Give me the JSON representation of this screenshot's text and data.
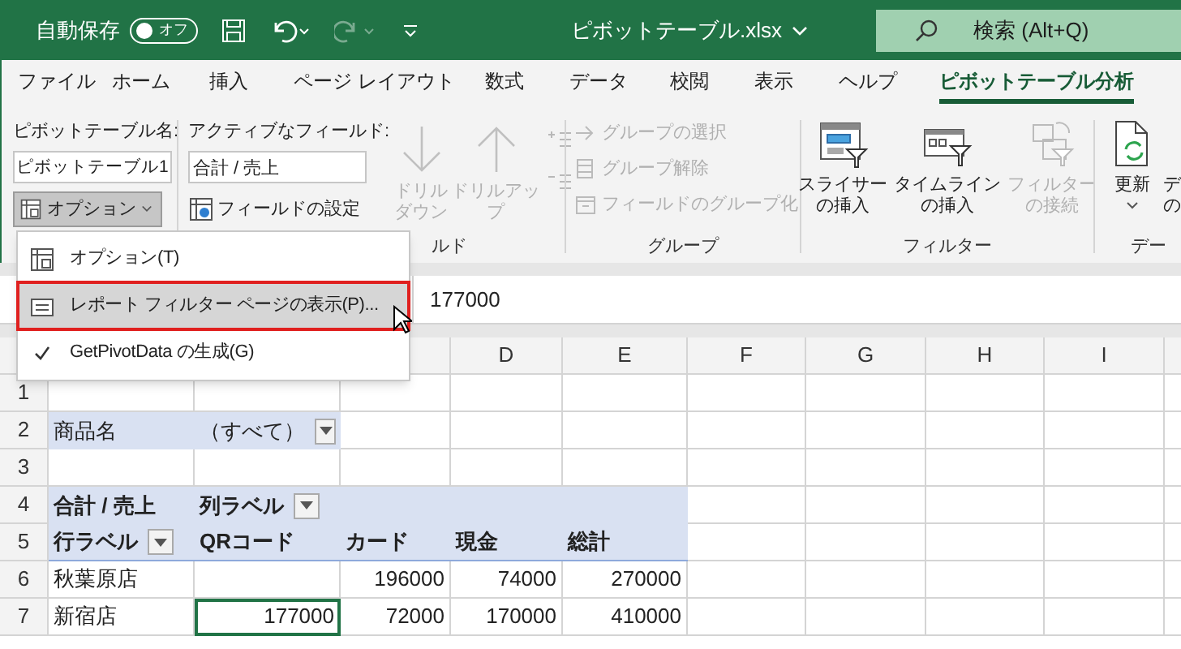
{
  "title_bar": {
    "autosave_label": "自動保存",
    "autosave_toggle": {
      "label": "オフ",
      "on": false
    },
    "filename": "ピボットテーブル.xlsx",
    "search_placeholder": "検索 (Alt+Q)",
    "redo_disabled": true
  },
  "tabs": [
    {
      "label": "ファイル",
      "selected": false
    },
    {
      "label": "ホーム",
      "selected": false
    },
    {
      "label": "挿入",
      "selected": false
    },
    {
      "label": "ページ レイアウト",
      "selected": false
    },
    {
      "label": "数式",
      "selected": false
    },
    {
      "label": "データ",
      "selected": false
    },
    {
      "label": "校閲",
      "selected": false
    },
    {
      "label": "表示",
      "selected": false
    },
    {
      "label": "ヘルプ",
      "selected": false
    },
    {
      "label": "ピボットテーブル分析",
      "selected": true
    }
  ],
  "ribbon": {
    "pivot_table": {
      "label": "ピボットテーブル名:",
      "value": "ピボットテーブル1",
      "options_button": {
        "label": "オプション",
        "expanded": true
      }
    },
    "active_field": {
      "label": "アクティブなフィールド:",
      "value": "合計 / 売上",
      "settings_button": "フィールドの設定",
      "drill_buttons": [
        {
          "kind": "down",
          "lines": [
            "ドリル",
            "ダウン"
          ],
          "disabled": true
        },
        {
          "kind": "up",
          "lines": [
            "ドリルアッ",
            "プ"
          ],
          "disabled": true
        }
      ],
      "group_label": "ルド"
    },
    "group": {
      "items": [
        {
          "kind": "select",
          "label": "グループの選択",
          "disabled": true
        },
        {
          "kind": "ungroup",
          "label": "グループ解除",
          "disabled": true
        },
        {
          "kind": "field",
          "label": "フィールドのグループ化",
          "disabled": true
        }
      ],
      "group_label": "グループ"
    },
    "filter": {
      "buttons": [
        {
          "kind": "slicer",
          "lines": [
            "スライサー",
            "の挿入"
          ],
          "disabled": false
        },
        {
          "kind": "timeline",
          "lines": [
            "タイムライン",
            "の挿入"
          ],
          "disabled": false
        },
        {
          "kind": "connect",
          "lines": [
            "フィルター",
            "の接続"
          ],
          "disabled": true
        }
      ],
      "group_label": "フィルター"
    },
    "data": {
      "refresh_label": "更新",
      "cut_button_lines": [
        "デ",
        "の"
      ],
      "group_label": "デー"
    }
  },
  "menu": {
    "items": [
      {
        "kind": "options",
        "label": "オプション(T)",
        "selected": false,
        "checked": false
      },
      {
        "kind": "report",
        "label": "レポート フィルター ページの表示(P)...",
        "selected": true,
        "checked": false
      },
      {
        "kind": "check",
        "label": "GetPivotData の生成(G)",
        "selected": false,
        "checked": true
      }
    ]
  },
  "formula_bar": {
    "value": "177000"
  },
  "sheet": {
    "columns": [
      "",
      "",
      "",
      "D",
      "E",
      "F",
      "G",
      "H",
      "I"
    ],
    "rows": [
      {
        "header": "1",
        "kind": "blank",
        "cells": []
      },
      {
        "header": "2",
        "kind": "filter",
        "cells": [
          "商品名",
          {
            "text": "（すべて）",
            "dropdown": true
          }
        ]
      },
      {
        "header": "3",
        "kind": "blank",
        "cells": []
      },
      {
        "header": "4",
        "kind": "header",
        "cells": [
          "合計 / 売上",
          {
            "text": "列ラベル",
            "dropdown": true
          }
        ]
      },
      {
        "header": "5",
        "kind": "header",
        "cells": [
          {
            "text": "行ラベル",
            "dropdown": true
          },
          "QRコード",
          "カード",
          "現金",
          "総計"
        ]
      },
      {
        "header": "6",
        "kind": "data",
        "cells": [
          "秋葉原店",
          "",
          "196000",
          "74000",
          "270000"
        ]
      },
      {
        "header": "7",
        "kind": "data",
        "cells": [
          {
            "text": "新宿店",
            "selected": false
          },
          {
            "text": "177000",
            "selected": true
          },
          {
            "text": "72000",
            "selected": false
          },
          {
            "text": "170000",
            "selected": false
          },
          {
            "text": "410000",
            "selected": false
          }
        ]
      }
    ]
  }
}
